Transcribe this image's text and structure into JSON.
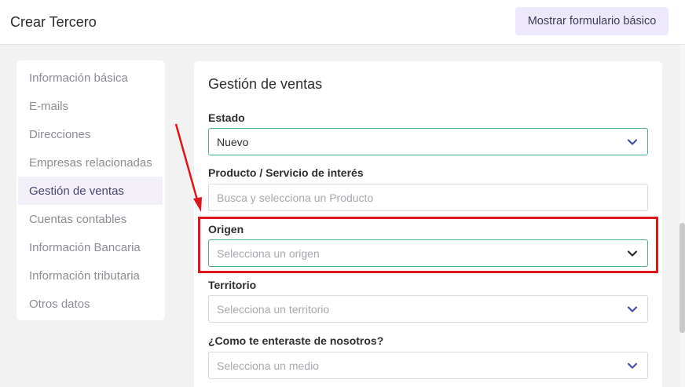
{
  "header": {
    "title": "Crear Tercero",
    "basic_form_button": "Mostrar formulario básico"
  },
  "sidebar": {
    "items": [
      {
        "label": "Información básica",
        "active": false
      },
      {
        "label": "E-mails",
        "active": false
      },
      {
        "label": "Direcciones",
        "active": false
      },
      {
        "label": "Empresas relacionadas",
        "active": false
      },
      {
        "label": "Gestión de ventas",
        "active": true
      },
      {
        "label": "Cuentas contables",
        "active": false
      },
      {
        "label": "Información Bancaria",
        "active": false
      },
      {
        "label": "Información tributaria",
        "active": false
      },
      {
        "label": "Otros datos",
        "active": false
      }
    ]
  },
  "section": {
    "title": "Gestión de ventas",
    "fields": {
      "estado": {
        "label": "Estado",
        "value": "Nuevo"
      },
      "producto": {
        "label": "Producto / Servicio de interés",
        "placeholder": "Busca y selecciona un Producto"
      },
      "origen": {
        "label": "Origen",
        "placeholder": "Selecciona un origen"
      },
      "territorio": {
        "label": "Territorio",
        "placeholder": "Selecciona un territorio"
      },
      "medio": {
        "label": "¿Como te enteraste de nosotros?",
        "placeholder": "Selecciona un medio"
      }
    }
  },
  "colors": {
    "accent": "#4fae92",
    "chevron": "#4450a8",
    "annotation": "#e0141b",
    "active_bg": "#f2eff9"
  },
  "icons": {
    "dropdown": "chevron-down-icon"
  }
}
